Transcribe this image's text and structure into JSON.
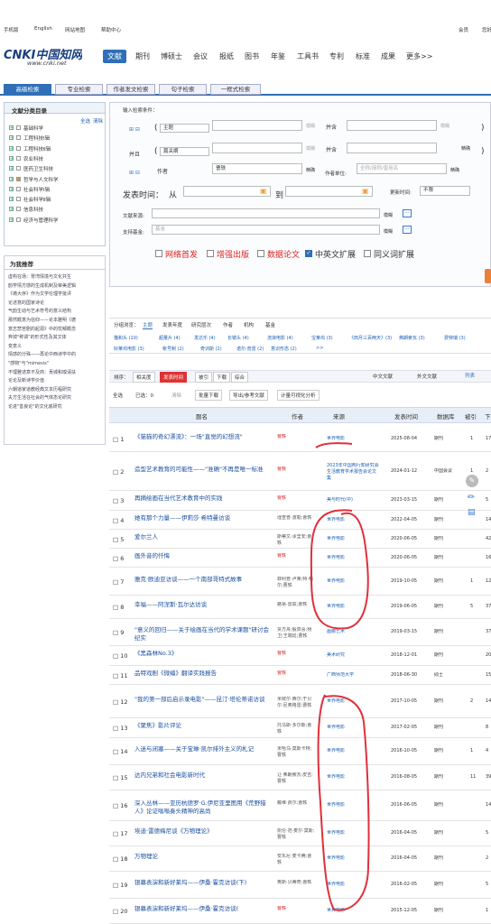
{
  "topbar": {
    "links": [
      "手机版",
      "English",
      "网站地图",
      "帮助中心"
    ],
    "right": [
      "会员",
      "您好"
    ]
  },
  "logo": {
    "text": "CNKI中国知网",
    "url": "www.cnki.net"
  },
  "nav": [
    "文献",
    "期刊",
    "博硕士",
    "会议",
    "报纸",
    "图书",
    "年鉴",
    "工具书",
    "专利",
    "标准",
    "成果",
    "更多>>"
  ],
  "search_tabs": [
    "高级检索",
    "专业检索",
    "作者发文检索",
    "句子检索",
    "一框式检索"
  ],
  "sidebar": {
    "title": "文献分类目录",
    "select_all": "全选",
    "clear": "清除",
    "items": [
      "基础科学",
      "工程科技Ⅰ辑",
      "工程科技Ⅱ辑",
      "农业科技",
      "医药卫生科技",
      "哲学与人文科学",
      "社会科学Ⅰ辑",
      "社会科学Ⅱ辑",
      "信息科技",
      "经济与管理科学"
    ],
    "rec_title": "为我推荐",
    "recs": [
      "虚构在场：胃湾情境与文化共生",
      "韵学情方感的生成机制及审美逻辑",
      "《祷大序》作为文学伦理学批评",
      "论述意的国家诗论",
      "气韵生动与艺术符号的意义结构",
      "那然概意为信仰——论本雅明《德",
      "意志悲苦剧的起源》中的忧郁概念",
      "弃掉\"称谓\"的形式性及其文体",
      "变意义",
      "情感的分殊——再论中西诗学中的",
      "\"感物\"与\"mimesis\"",
      "不理雅述意不及商：贡城和嗅请扶",
      "论论及新诗学价值",
      "六朝道家道教经典文本历程研究",
      "夫方生活在社会的气体态论研究",
      "论进\"善良论\"的文化底研究"
    ]
  },
  "form": {
    "label_input": "输入检索条件：",
    "field1": "主题",
    "field2": "篇关摘",
    "and1": "并且",
    "author": "作者",
    "author_value": "曹轶",
    "exact": "精确",
    "and": "并含",
    "unit_label": "作者单位:",
    "unit_placeholder": "全称/简称/曾用名",
    "pub_time": "发表时间：",
    "from": "从",
    "to": "到",
    "update_time": "更新时间:",
    "unlimited": "不限",
    "source": "文献来源:",
    "fund": "支持基金:",
    "fund_ph": "基金",
    "fuzzy": "模糊",
    "opts": [
      "网络首发",
      "增强出版",
      "数据论文",
      "中英文扩展",
      "同义词扩展"
    ],
    "opts_checked": [
      false,
      false,
      false,
      true,
      false
    ]
  },
  "group": {
    "label": "分组浏览：",
    "tabs": [
      "主题",
      "发表年度",
      "研究层次",
      "作者",
      "机构",
      "基金"
    ],
    "items": [
      "猫和头 (10)",
      "超量片 (4)",
      "发达乐 (4)",
      "长镜头 (4)",
      "流浪电影 (4)",
      "宝莱坞 (3)",
      "《田月三百两天》(3)",
      "弗朗索瓦 (3)",
      "费特瑞 (3)",
      "好莱坞电影 (3)",
      "帐号制 (2)",
      "奇训斯 (2)",
      "诺尔·普雷 (2)",
      "意识形态 (2)",
      ">>"
    ]
  },
  "sort": {
    "label": "排序：",
    "items": [
      "相关度",
      "发表时间",
      "被引",
      "下载",
      "综合"
    ],
    "right": [
      "中文文献",
      "外文文献"
    ],
    "listbtn": "列表"
  },
  "toolbar": {
    "select_all": "全选",
    "selected": "已选：0",
    "clear": "清除",
    "batch": "批量下载",
    "export": "导出/参考文献",
    "analyze": "计量可视化分析"
  },
  "table": {
    "headers": [
      "题名",
      "作者",
      "来源",
      "发表时间",
      "数据库",
      "被引",
      "下"
    ],
    "rows": [
      {
        "n": "1",
        "title": "《猫猫的奇幻漂流》：一场\"直觉的幻想流\"",
        "author": "曹轶",
        "source": "世界电影",
        "date": "2025-08-04",
        "db": "期刊",
        "cite": "1",
        "dl": "17"
      },
      {
        "n": "2",
        "title": "造型艺术教育的可能性——\"准确\"不再是唯一标准",
        "author": "曹轶",
        "source": "2023年中国陶行知研究会生活教育学术报告会论文集",
        "date": "2024-01-12",
        "db": "中国会议",
        "cite": "1",
        "dl": "2"
      },
      {
        "n": "3",
        "title": "再摘绘画在当代艺术教育中的实践",
        "author": "曹轶",
        "source": "美与时代(中)",
        "date": "2023-03-15",
        "db": "期刊",
        "cite": "",
        "dl": "5"
      },
      {
        "n": "4",
        "title": "她有那个力量——伊莉莎·希特曼访谈",
        "author": "瑾查普·波勒;曹轶",
        "source": "世界电影",
        "date": "2022-04-05",
        "db": "期刊",
        "cite": "",
        "dl": "14"
      },
      {
        "n": "5",
        "title": "爱尔兰人",
        "author": "斯蒂文·泽里安;曹轶",
        "source": "世界电影",
        "date": "2020-06-05",
        "db": "期刊",
        "cite": "",
        "dl": "42"
      },
      {
        "n": "6",
        "title": "画外音的忏悔",
        "author": "曹轶",
        "source": "世界电影",
        "date": "2020-06-05",
        "db": "期刊",
        "cite": "",
        "dl": "16"
      },
      {
        "n": "7",
        "title": "雅克·欧迪亚访谈——一个南部哥特式故事",
        "author": "菲利普·卢莱;特·帕尔;曹轶",
        "source": "世界电影",
        "date": "2019-10-05",
        "db": "期刊",
        "cite": "1",
        "dl": "12"
      },
      {
        "n": "8",
        "title": "幸福——阿涅斯·瓦尔达访谈",
        "author": "路易·雷兹;曹轶",
        "source": "世界电影",
        "date": "2019-06-05",
        "db": "期刊",
        "cite": "5",
        "dl": "37"
      },
      {
        "n": "9",
        "title": "\"意义的回归——关于绘画在当代的学术课题\"研讨会纪实",
        "author": "贾方舟;殷双喜;杨卫;王端廷;曹轶",
        "source": "画廊艺术",
        "date": "2019-03-15",
        "db": "期刊",
        "cite": "",
        "dl": "37"
      },
      {
        "n": "10",
        "title": "《黑森林No.3》",
        "author": "曹轶",
        "source": "美术研究",
        "date": "2018-12-01",
        "db": "期刊",
        "cite": "",
        "dl": "20"
      },
      {
        "n": "11",
        "title": "品特戏剧《微编》翻译实践报告",
        "author": "曹轶",
        "source": "广西师范大学",
        "date": "2018-06-30",
        "db": "硕士",
        "cite": "",
        "dl": "15"
      },
      {
        "n": "12",
        "title": "\"我的第一部后启示录电影\"——昆汀·塔伦蒂诺访谈",
        "author": "米歇尔·西尔;于贝尔·尼奥格雷;曹轶",
        "source": "世界电影",
        "date": "2017-10-05",
        "db": "期刊",
        "cite": "2",
        "dl": "14"
      },
      {
        "n": "13",
        "title": "《聚焦》影片评论",
        "author": "托马斯·多尔斯;曹轶",
        "source": "世界电影",
        "date": "2017-02-05",
        "db": "期刊",
        "cite": "",
        "dl": "8"
      },
      {
        "n": "14",
        "title": "入迷与闭塞——关于宝琳·凯尔排外主义的札记",
        "author": "米哈乌·莫斯卡特;曹轶",
        "source": "世界电影",
        "date": "2016-10-05",
        "db": "期刊",
        "cite": "1",
        "dl": "4"
      },
      {
        "n": "15",
        "title": "达内兄弟和社会电影新时代",
        "author": "让·弗朗索瓦·皮吉;曹轶",
        "source": "世界电影",
        "date": "2016-08-05",
        "db": "期刊",
        "cite": "11",
        "dl": "39"
      },
      {
        "n": "16",
        "title": "深入丛林——亚历杭德罗·G.伊尼亚里图用《荒野猎人》论证嗡嗡奏头精神的高尚",
        "author": "戴维·费尔;曹轶",
        "source": "世界电影",
        "date": "2016-06-05",
        "db": "期刊",
        "cite": "",
        "dl": "14"
      },
      {
        "n": "17",
        "title": "埃迪·雷德梅尼谈《万物理论》",
        "author": "凯伦·范·麦尔·莫斯;曹轶",
        "source": "世界电影",
        "date": "2016-04-05",
        "db": "期刊",
        "cite": "",
        "dl": "5"
      },
      {
        "n": "18",
        "title": "万物理论",
        "author": "安东尼·麦卡腾;曹轶",
        "source": "世界电影",
        "date": "2016-04-05",
        "db": "期刊",
        "cite": "",
        "dl": "2"
      },
      {
        "n": "19",
        "title": "银幕表演和新好莱坞——伊桑·霍克访谈(下)",
        "author": "奥斯·贝蒂奇;曹轶",
        "source": "世界电影",
        "date": "2016-02-05",
        "db": "期刊",
        "cite": "",
        "dl": "5"
      },
      {
        "n": "20",
        "title": "银幕表演和新好莱坞——伊桑·霍克访谈(",
        "author": "曹轶",
        "source": "世界电影",
        "date": "2015-12-05",
        "db": "期刊",
        "cite": "",
        "dl": "1"
      }
    ]
  },
  "colors": {
    "accent": "#1a5fb4",
    "red": "#d22",
    "annotation": "#e0303a"
  }
}
